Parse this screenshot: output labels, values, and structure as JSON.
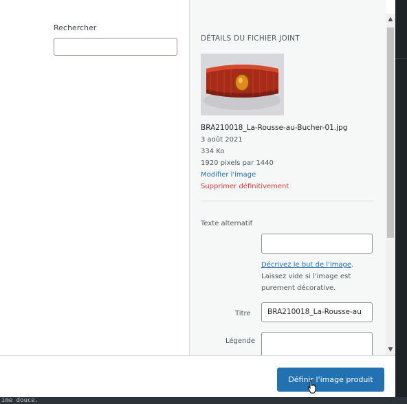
{
  "search": {
    "label": "Rechercher",
    "value": ""
  },
  "details": {
    "heading": "DÉTAILS DU FICHIER JOINT",
    "filename": "BRA210018_La-Rousse-au-Bucher-01.jpg",
    "date": "3 août 2021",
    "size": "334 Ko",
    "dimensions": "1920 pixels par 1440",
    "edit_link": "Modifier l'image",
    "delete_link": "Supprimer définitivement"
  },
  "fields": {
    "alt_label": "Texte alternatif",
    "alt_value": "",
    "alt_help_link": "Décrivez le but de l'image",
    "alt_help_suffix": ".",
    "alt_help_text": "Laissez vide si l'image est purement décorative.",
    "title_label": "Titre",
    "title_value": "BRA210018_La-Rousse-au",
    "caption_label": "Légende",
    "caption_value": ""
  },
  "toolbar": {
    "primary_label": "Définir l'image produit"
  },
  "background_text": "ime douce.",
  "colors": {
    "accent": "#2271b1",
    "danger": "#d63638",
    "product": "#b5321c"
  },
  "icons": [
    "scroll-up-icon",
    "scroll-down-icon",
    "pointer-cursor-icon"
  ]
}
